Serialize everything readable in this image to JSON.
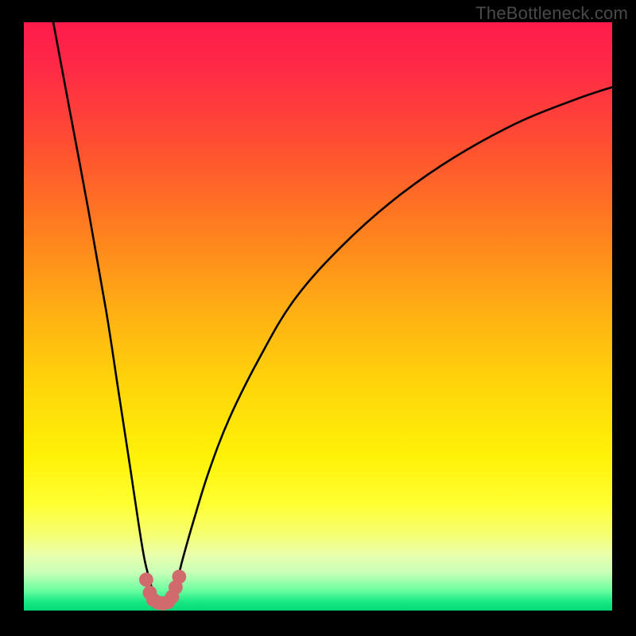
{
  "attribution": "TheBottleneck.com",
  "colors": {
    "frame": "#000000",
    "curve": "#000000",
    "markers": "#d06a6c",
    "gradient_stops": [
      {
        "offset": 0.0,
        "color": "#ff1b4b"
      },
      {
        "offset": 0.08,
        "color": "#ff2a46"
      },
      {
        "offset": 0.2,
        "color": "#ff4c33"
      },
      {
        "offset": 0.35,
        "color": "#ff7e1f"
      },
      {
        "offset": 0.5,
        "color": "#ffb213"
      },
      {
        "offset": 0.62,
        "color": "#ffd60a"
      },
      {
        "offset": 0.74,
        "color": "#fff207"
      },
      {
        "offset": 0.82,
        "color": "#ffff33"
      },
      {
        "offset": 0.87,
        "color": "#f6ff70"
      },
      {
        "offset": 0.905,
        "color": "#eaffab"
      },
      {
        "offset": 0.935,
        "color": "#c9ffb8"
      },
      {
        "offset": 0.965,
        "color": "#6effa1"
      },
      {
        "offset": 0.985,
        "color": "#18e884"
      },
      {
        "offset": 1.0,
        "color": "#06d877"
      }
    ]
  },
  "chart_data": {
    "type": "line",
    "title": "",
    "xlabel": "",
    "ylabel": "",
    "xlim": [
      0,
      100
    ],
    "ylim": [
      0,
      100
    ],
    "grid": false,
    "series": [
      {
        "name": "left-branch",
        "x": [
          5.0,
          8.0,
          11.0,
          14.0,
          16.0,
          18.0,
          19.5,
          20.5,
          21.5,
          22.4
        ],
        "values": [
          100,
          84,
          68,
          51,
          38,
          25,
          15,
          9,
          5,
          2
        ]
      },
      {
        "name": "right-branch",
        "x": [
          25.0,
          26.0,
          27.0,
          29.0,
          31.5,
          35.0,
          40.0,
          46.0,
          54.0,
          63.0,
          73.0,
          84.0,
          94.0,
          100.0
        ],
        "values": [
          2,
          5,
          9,
          16,
          24,
          33,
          43,
          53,
          62,
          70,
          77,
          83,
          87,
          89
        ]
      }
    ],
    "floor_band": {
      "y_from": 0,
      "y_to": 2
    },
    "markers": {
      "name": "valley-points",
      "points": [
        {
          "x": 20.8,
          "y": 5.5
        },
        {
          "x": 21.4,
          "y": 3.3
        },
        {
          "x": 22.0,
          "y": 2.1
        },
        {
          "x": 22.8,
          "y": 1.6
        },
        {
          "x": 23.7,
          "y": 1.5
        },
        {
          "x": 24.5,
          "y": 1.7
        },
        {
          "x": 25.2,
          "y": 2.6
        },
        {
          "x": 25.8,
          "y": 4.2
        },
        {
          "x": 26.4,
          "y": 6.0
        }
      ],
      "radius": 1.2
    }
  }
}
